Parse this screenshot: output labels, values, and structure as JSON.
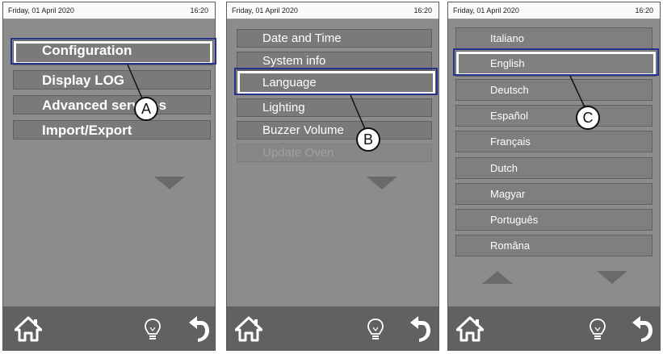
{
  "colors": {
    "screen_bg": "#8c8c8c",
    "button_bg": "#7a7a7a",
    "bottom_bar": "#616161",
    "highlight_frame": "#26328a",
    "text": "#ffffff"
  },
  "screens": [
    {
      "status": {
        "date": "Friday, 01 April 2020",
        "time": "16:20"
      },
      "menu": [
        "Configuration",
        "Display LOG",
        "Advanced services",
        "Import/Export"
      ],
      "selected_index": 0,
      "callout": "A"
    },
    {
      "status": {
        "date": "Friday, 01 April 2020",
        "time": "16:20"
      },
      "menu": [
        "Date and Time",
        "System info",
        "Language",
        "Lighting",
        "Buzzer Volume",
        "Update Oven"
      ],
      "selected_index": 2,
      "disabled_index": 5,
      "callout": "B"
    },
    {
      "status": {
        "date": "Friday, 01 April 2020",
        "time": "16:20"
      },
      "languages": [
        "Italiano",
        "English",
        "Deutsch",
        "Español",
        "Français",
        "Dutch",
        "Magyar",
        "Português",
        "Româna"
      ],
      "selected_index": 1,
      "callout": "C"
    }
  ],
  "bottom_icons": [
    "home-icon",
    "lightbulb-icon",
    "back-arrow-icon"
  ]
}
